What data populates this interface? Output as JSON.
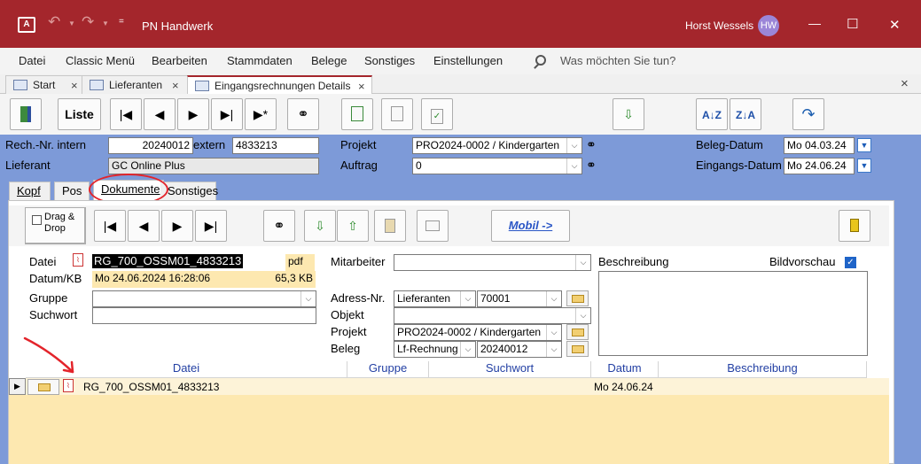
{
  "app": {
    "title": "PN Handwerk",
    "user": "Horst Wessels",
    "initials": "HW"
  },
  "window": {
    "min": "—",
    "max": "☐",
    "close": "✕"
  },
  "menu": {
    "items": [
      "Datei",
      "Classic Menü",
      "Bearbeiten",
      "Stammdaten",
      "Belege",
      "Sonstiges",
      "Einstellungen"
    ],
    "search": "Was möchten Sie tun?"
  },
  "doctabs": [
    {
      "label": "Start"
    },
    {
      "label": "Lieferanten"
    },
    {
      "label": "Eingangsrechnungen Details"
    }
  ],
  "toolbar": {
    "liste": "Liste"
  },
  "header": {
    "rechnr_label": "Rech.-Nr. intern",
    "rechnr": "20240012",
    "extern_label": "extern",
    "extern": "4833213",
    "lieferant_label": "Lieferant",
    "lieferant": "GC Online Plus",
    "projekt_label": "Projekt",
    "projekt": "PRO2024-0002 / Kindergarten",
    "auftrag_label": "Auftrag",
    "auftrag": "0",
    "belegdatum_label": "Beleg-Datum",
    "belegdatum": "Mo 04.03.24",
    "eingangsdatum_label": "Eingangs-Datum",
    "eingangsdatum": "Mo 24.06.24"
  },
  "pagetabs": [
    "Kopf",
    "Pos",
    "Dokumente",
    "Sonstiges"
  ],
  "dok": {
    "dragdrop": "Drag & Drop",
    "mobil": "Mobil ->",
    "datei_label": "Datei",
    "datei": "RG_700_OSSM01_4833213",
    "ext": "pdf",
    "datumkb_label": "Datum/KB",
    "datum": "Mo 24.06.2024 16:28:06",
    "kb": "65,3 KB",
    "gruppe_label": "Gruppe",
    "gruppe": "",
    "suchwort_label": "Suchwort",
    "suchwort": "",
    "mitarbeiter_label": "Mitarbeiter",
    "mitarbeiter": "",
    "beschreibung_label": "Beschreibung",
    "bildvorschau_label": "Bildvorschau",
    "adressnr_label": "Adress-Nr.",
    "adresstyp": "Lieferanten",
    "adressnr": "70001",
    "objekt_label": "Objekt",
    "objekt": "",
    "projekt_label": "Projekt",
    "projekt": "PRO2024-0002 / Kindergarten",
    "beleg_label": "Beleg",
    "belegtyp": "Lf-Rechnung",
    "beleg": "20240012"
  },
  "grid": {
    "columns": [
      "Datei",
      "Gruppe",
      "Suchwort",
      "Datum",
      "Beschreibung"
    ],
    "rows": [
      {
        "datei": "RG_700_OSSM01_4833213",
        "gruppe": "",
        "suchwort": "",
        "datum": "Mo 24.06.24",
        "beschreibung": ""
      }
    ]
  },
  "colors": {
    "accent": "#a4262c",
    "form_bg": "#7d9ad8",
    "row_bg": "#fde8b0",
    "annotation": "#e3242b"
  }
}
